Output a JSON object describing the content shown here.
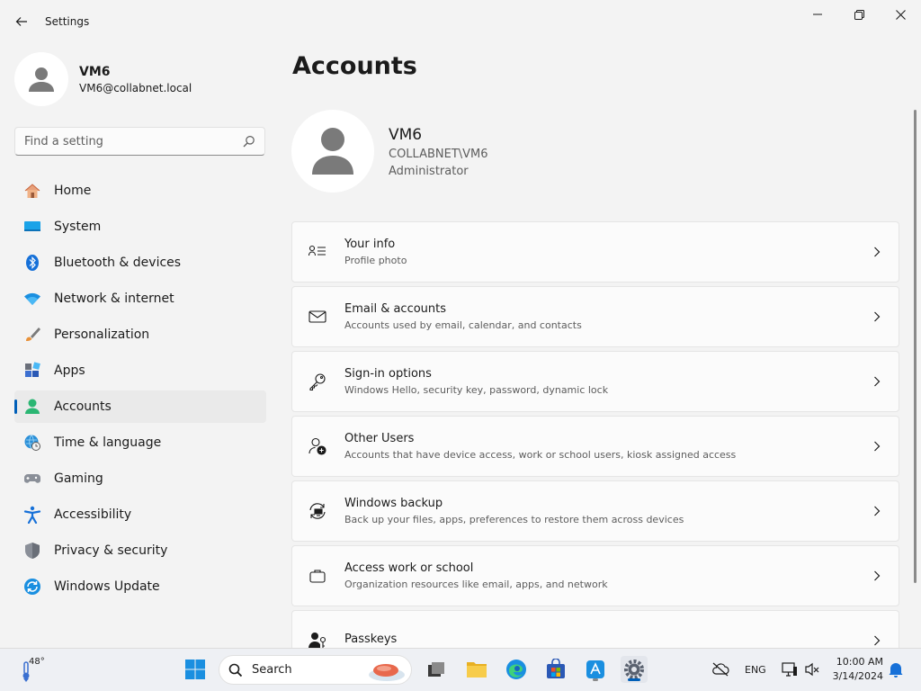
{
  "window": {
    "title": "Settings",
    "back_icon": "back-arrow-icon",
    "controls": [
      "minimize-icon",
      "restore-icon",
      "close-icon"
    ]
  },
  "profile": {
    "name": "VM6",
    "email": "VM6@collabnet.local"
  },
  "search": {
    "placeholder": "Find a setting",
    "value": ""
  },
  "nav": {
    "active": "Accounts",
    "items": [
      {
        "label": "Home",
        "icon": "home-icon"
      },
      {
        "label": "System",
        "icon": "monitor-icon"
      },
      {
        "label": "Bluetooth & devices",
        "icon": "bluetooth-icon"
      },
      {
        "label": "Network & internet",
        "icon": "wifi-icon"
      },
      {
        "label": "Personalization",
        "icon": "brush-icon"
      },
      {
        "label": "Apps",
        "icon": "apps-icon"
      },
      {
        "label": "Accounts",
        "icon": "person-icon"
      },
      {
        "label": "Time & language",
        "icon": "globe-clock-icon"
      },
      {
        "label": "Gaming",
        "icon": "gamepad-icon"
      },
      {
        "label": "Accessibility",
        "icon": "accessibility-icon"
      },
      {
        "label": "Privacy & security",
        "icon": "shield-icon"
      },
      {
        "label": "Windows Update",
        "icon": "update-icon"
      }
    ]
  },
  "main": {
    "title": "Accounts",
    "user": {
      "name": "VM6",
      "domain": "COLLABNET\\VM6",
      "role": "Administrator"
    },
    "cards": [
      {
        "title": "Your info",
        "subtitle": "Profile photo",
        "icon": "person-info-icon"
      },
      {
        "title": "Email & accounts",
        "subtitle": "Accounts used by email, calendar, and contacts",
        "icon": "mail-icon"
      },
      {
        "title": "Sign-in options",
        "subtitle": "Windows Hello, security key, password, dynamic lock",
        "icon": "key-icon"
      },
      {
        "title": "Other Users",
        "subtitle": "Accounts that have device access, work or school users, kiosk assigned access",
        "icon": "add-user-icon"
      },
      {
        "title": "Windows backup",
        "subtitle": "Back up your files, apps, preferences to restore them across devices",
        "icon": "backup-icon"
      },
      {
        "title": "Access work or school",
        "subtitle": "Organization resources like email, apps, and network",
        "icon": "briefcase-icon"
      },
      {
        "title": "Passkeys",
        "subtitle": "",
        "icon": "passkey-icon"
      }
    ]
  },
  "taskbar": {
    "weather_temp": "48°",
    "search_label": "Search",
    "language": "ENG",
    "time": "10:00 AM",
    "date": "3/14/2024"
  },
  "colors": {
    "accent": "#005fb8",
    "background": "#f3f3f3",
    "card": "#fbfbfb"
  }
}
